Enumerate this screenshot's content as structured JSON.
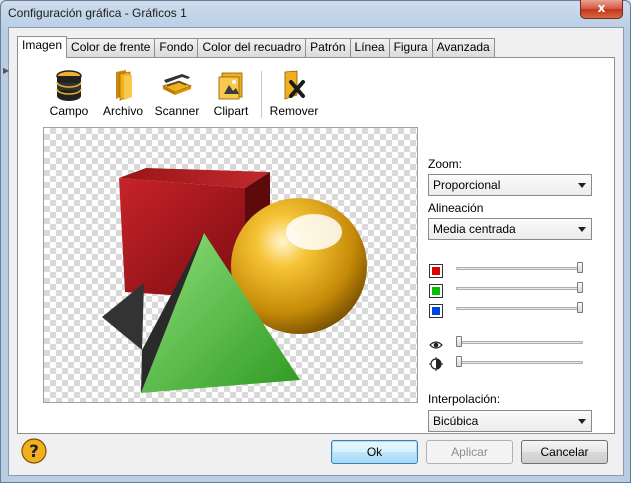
{
  "window": {
    "title": "Configuración gráfica - Gráficos 1",
    "close_glyph": "x"
  },
  "tabs": [
    {
      "label": "Imagen",
      "active": true
    },
    {
      "label": "Color de frente"
    },
    {
      "label": "Fondo"
    },
    {
      "label": "Color del recuadro"
    },
    {
      "label": "Patrón"
    },
    {
      "label": "Línea"
    },
    {
      "label": "Figura"
    },
    {
      "label": "Avanzada"
    }
  ],
  "toolbar": {
    "campo": "Campo",
    "archivo": "Archivo",
    "scanner": "Scanner",
    "clipart": "Clipart",
    "remover": "Remover"
  },
  "zoom": {
    "label": "Zoom:",
    "value": "Proporcional"
  },
  "alineacion": {
    "label": "Alineación",
    "value": "Media centrada"
  },
  "colors": {
    "red": "#e00000",
    "green": "#00c000",
    "blue": "#0044e0"
  },
  "sliders": {
    "red": 1.0,
    "green": 1.0,
    "blue": 1.0,
    "brightness": 0.0,
    "contrast": 0.0
  },
  "interpolacion": {
    "label": "Interpolación:",
    "value": "Bicúbica"
  },
  "buttons": {
    "ok": "Ok",
    "aplicar": "Aplicar",
    "cancelar": "Cancelar"
  },
  "icons": [
    "database-icon",
    "folder-icon",
    "scanner-icon",
    "clipart-icon",
    "remove-icon",
    "eye-icon",
    "contrast-icon",
    "help-icon"
  ]
}
